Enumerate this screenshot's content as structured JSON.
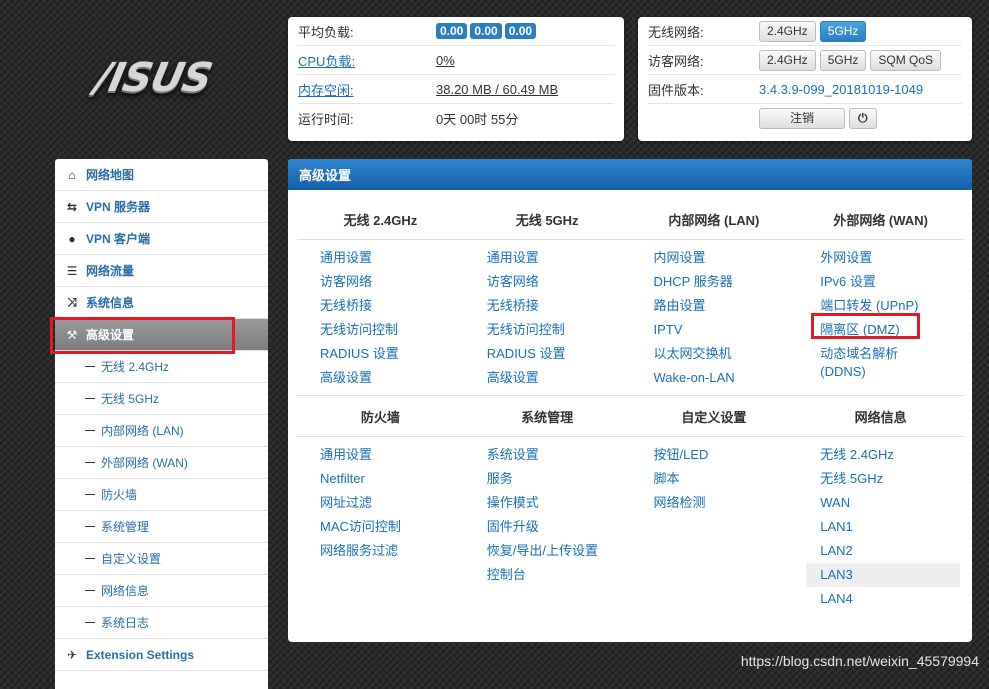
{
  "logo": {
    "text": "/ISUS"
  },
  "status": {
    "load_label": "平均负载:",
    "load_values": [
      "0.00",
      "0.00",
      "0.00"
    ],
    "cpu_label": "CPU负载:",
    "cpu_value": "0%",
    "mem_label": "内存空闲:",
    "mem_value": "38.20 MB / 60.49 MB",
    "uptime_label": "运行时间:",
    "uptime_value": "0天 00时 55分"
  },
  "device": {
    "wireless_label": "无线网络:",
    "wireless_btns": [
      "2.4GHz",
      "5GHz"
    ],
    "guest_label": "访客网络:",
    "guest_btns": [
      "2.4GHz",
      "5GHz",
      "SQM QoS"
    ],
    "firmware_label": "固件版本:",
    "firmware_value": "3.4.3.9-099_20181019-1049",
    "logout_label": "注销",
    "power_icon": "⏻"
  },
  "sidebar": {
    "items": [
      {
        "label": "网络地图",
        "icon": "home-icon"
      },
      {
        "label": "VPN 服务器",
        "icon": "swap-icon"
      },
      {
        "label": "VPN 客户端",
        "icon": "globe-icon"
      },
      {
        "label": "网络流量",
        "icon": "list-icon"
      },
      {
        "label": "系统信息",
        "icon": "shuffle-icon"
      },
      {
        "label": "高级设置",
        "icon": "wrench-icon"
      }
    ],
    "subitems": [
      "无线 2.4GHz",
      "无线 5GHz",
      "内部网络 (LAN)",
      "外部网络 (WAN)",
      "防火墙",
      "系统管理",
      "自定义设置",
      "网络信息",
      "系统日志"
    ],
    "extension_label": "Extension Settings"
  },
  "main": {
    "title": "高级设置",
    "section1": {
      "headers": [
        "无线 2.4GHz",
        "无线 5GHz",
        "内部网络 (LAN)",
        "外部网络 (WAN)"
      ],
      "col1": [
        "通用设置",
        "访客网络",
        "无线桥接",
        "无线访问控制",
        "RADIUS 设置",
        "高级设置"
      ],
      "col2": [
        "通用设置",
        "访客网络",
        "无线桥接",
        "无线访问控制",
        "RADIUS 设置",
        "高级设置"
      ],
      "col3": [
        "内网设置",
        "DHCP 服务器",
        "路由设置",
        "IPTV",
        "以太网交换机",
        "Wake-on-LAN"
      ],
      "col4": [
        "外网设置",
        "IPv6 设置",
        "端口转发 (UPnP)",
        "隔离区 (DMZ)",
        "动态域名解析",
        "(DDNS)"
      ]
    },
    "section2": {
      "headers": [
        "防火墙",
        "系统管理",
        "自定义设置",
        "网络信息"
      ],
      "col1": [
        "通用设置",
        "Netfilter",
        "网址过滤",
        "MAC访问控制",
        "网络服务过滤"
      ],
      "col2": [
        "系统设置",
        "服务",
        "操作模式",
        "固件升级",
        "恢复/导出/上传设置",
        "控制台"
      ],
      "col3": [
        "按钮/LED",
        "脚本",
        "网络检测"
      ],
      "col4": [
        "无线 2.4GHz",
        "无线 5GHz",
        "WAN",
        "LAN1",
        "LAN2",
        "LAN3",
        "LAN4"
      ]
    }
  },
  "watermark": "https://blog.csdn.net/weixin_45579994",
  "colors": {
    "accent": "#2b7fc0",
    "highlight": "#e01b24",
    "link": "#1a6fb9"
  }
}
